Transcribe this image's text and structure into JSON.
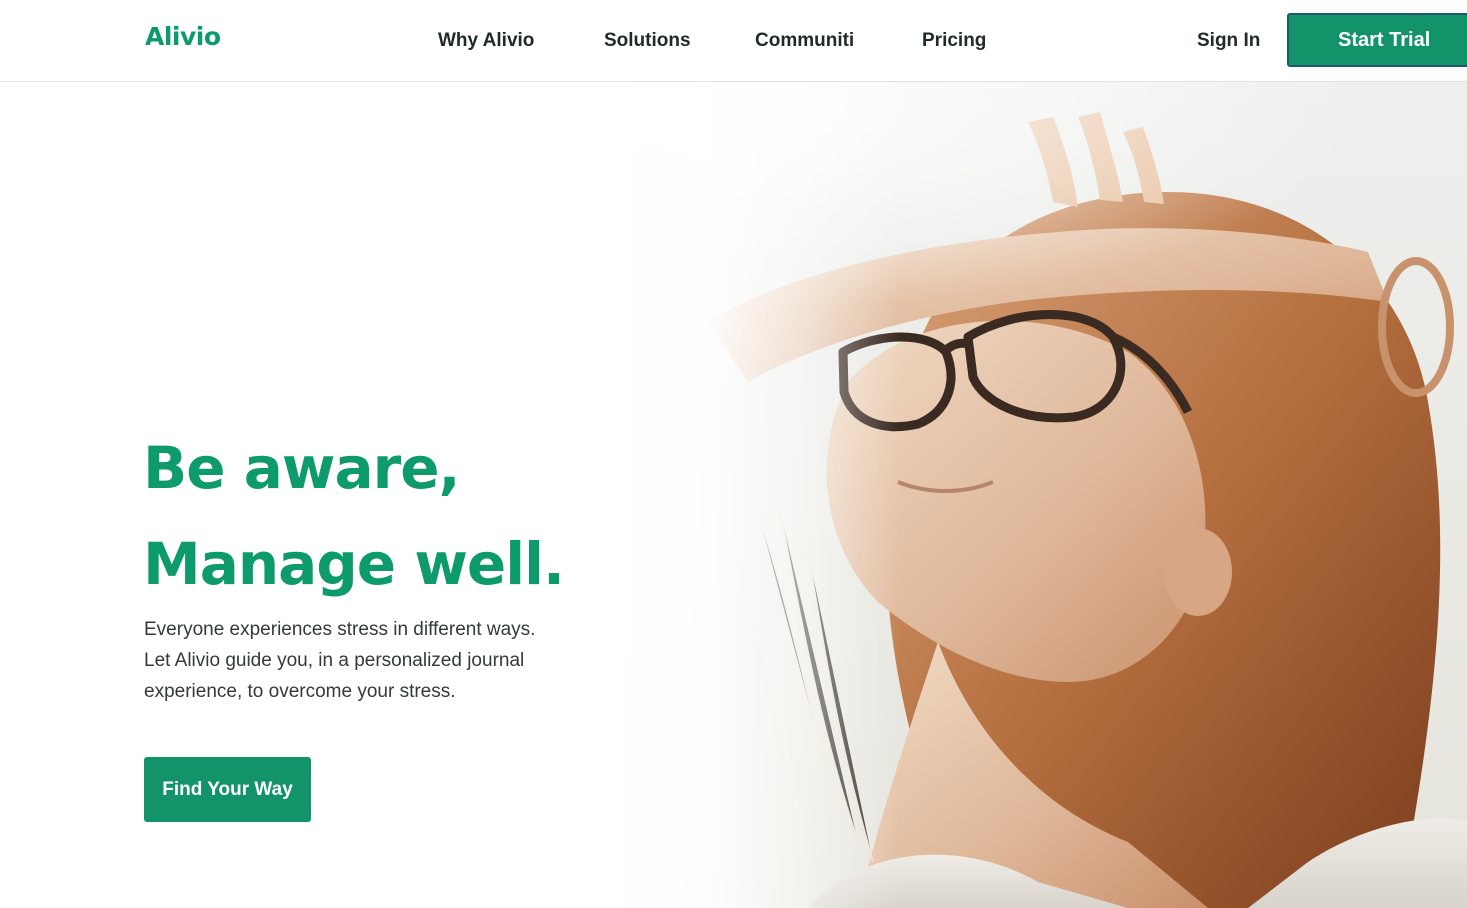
{
  "nav": {
    "brand": "Alivio",
    "links": [
      "Why Alivio",
      "Solutions",
      "Communiti",
      "Pricing"
    ],
    "sign_in": "Sign In",
    "start_trial": "Start Trial"
  },
  "hero": {
    "headline_line1": "Be aware,",
    "headline_line2": "Manage well.",
    "subcopy_lines": [
      "Everyone experiences stress in different ways.",
      "Let Alivio guide you, in a personalized journal",
      "experience, to overcome your stress."
    ],
    "cta": "Find Your Way"
  },
  "colors": {
    "brand_green": "#0e9b6b",
    "button_green": "#13936a",
    "text_dark": "#1f2a2a"
  }
}
